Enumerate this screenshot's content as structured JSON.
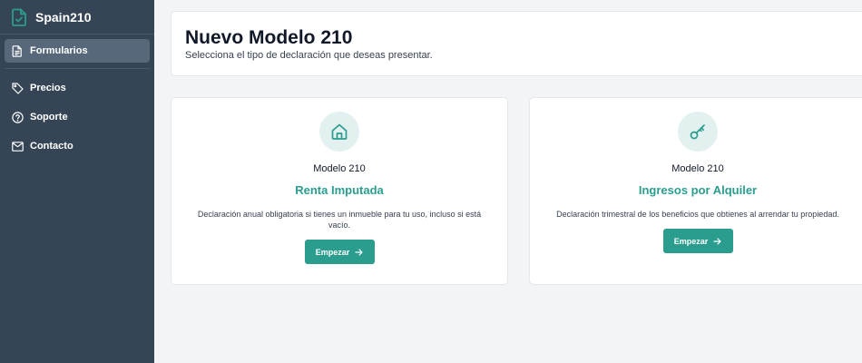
{
  "brand": {
    "name": "Spain210",
    "icon": "document-check-icon"
  },
  "sidebar": {
    "items": [
      {
        "label": "Formularios",
        "icon": "document-icon",
        "active": true
      },
      {
        "label": "Precios",
        "icon": "tag-icon"
      },
      {
        "label": "Soporte",
        "icon": "question-circle-icon"
      },
      {
        "label": "Contacto",
        "icon": "mail-icon"
      }
    ]
  },
  "header": {
    "title": "Nuevo Modelo 210",
    "subtitle": "Selecciona el tipo de declaración que deseas presentar."
  },
  "cards": [
    {
      "icon": "home-icon",
      "model": "Modelo 210",
      "title": "Renta Imputada",
      "description": "Declaración anual obligatoria si tienes un inmueble para tu uso, incluso si está vacío.",
      "button": "Empezar"
    },
    {
      "icon": "key-icon",
      "model": "Modelo 210",
      "title": "Ingresos por Alquiler",
      "description": "Declaración trimestral de los beneficios que obtienes al arrendar tu propiedad.",
      "button": "Empezar"
    }
  ],
  "colors": {
    "sidebar": "#354555",
    "accent": "#2a9d8f",
    "background": "#f3f4f6"
  }
}
